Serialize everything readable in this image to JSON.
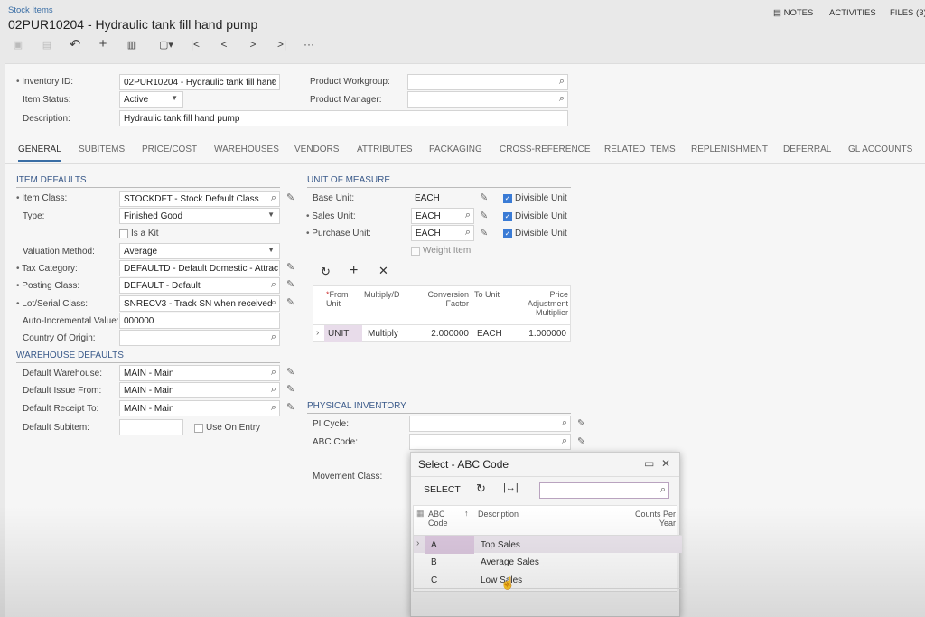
{
  "header": {
    "breadcrumb": "Stock Items",
    "title": "02PUR10204 - Hydraulic tank fill hand pump",
    "notes": "NOTES",
    "activities": "ACTIVITIES",
    "files": "FILES (3)"
  },
  "toolbar": {
    "icons": [
      "save-close-icon",
      "save-icon",
      "undo-icon",
      "add-icon",
      "delete-icon",
      "copy-paste-icon",
      "first-icon",
      "previous-icon",
      "next-icon",
      "last-icon",
      "more-icon"
    ],
    "glyphs": {
      "undo": "↶",
      "add": "+",
      "delete": "🗑",
      "copy": "▢▾",
      "first": "|<",
      "prev": "<",
      "next": ">",
      "last": ">|",
      "more": "···"
    }
  },
  "summary": {
    "inventory_id_label": "Inventory ID:",
    "inventory_id": "02PUR10204 - Hydraulic tank fill hand",
    "item_status_label": "Item Status:",
    "item_status": "Active",
    "description_label": "Description:",
    "description": "Hydraulic tank fill hand pump",
    "product_workgroup_label": "Product Workgroup:",
    "product_workgroup": "",
    "product_manager_label": "Product Manager:",
    "product_manager": ""
  },
  "tabs": [
    "GENERAL",
    "SUBITEMS",
    "PRICE/COST",
    "WAREHOUSES",
    "VENDORS",
    "ATTRIBUTES",
    "PACKAGING",
    "CROSS-REFERENCE",
    "RELATED ITEMS",
    "REPLENISHMENT",
    "DEFERRAL",
    "GL ACCOUNTS"
  ],
  "item_defaults": {
    "header": "ITEM DEFAULTS",
    "item_class_label": "Item Class:",
    "item_class": "STOCKDFT - Stock Default Class",
    "type_label": "Type:",
    "type": "Finished Good",
    "is_kit_label": "Is a Kit",
    "is_kit": false,
    "valuation_label": "Valuation Method:",
    "valuation": "Average",
    "tax_label": "Tax Category:",
    "tax": "DEFAULTD - Default Domestic - Attrac",
    "posting_label": "Posting Class:",
    "posting": "DEFAULT - Default",
    "lot_label": "Lot/Serial Class:",
    "lot": "SNRECV3 - Track SN when received",
    "auto_label": "Auto-Incremental Value:",
    "auto": "000000",
    "country_label": "Country Of Origin:",
    "country": ""
  },
  "warehouse_defaults": {
    "header": "WAREHOUSE DEFAULTS",
    "warehouse_label": "Default Warehouse:",
    "warehouse": "MAIN - Main",
    "issue_label": "Default Issue From:",
    "issue": "MAIN - Main",
    "receipt_label": "Default Receipt To:",
    "receipt": "MAIN - Main",
    "subitem_label": "Default Subitem:",
    "subitem": "",
    "use_on_entry_label": "Use On Entry",
    "use_on_entry": false
  },
  "uom": {
    "header": "UNIT OF MEASURE",
    "base_label": "Base Unit:",
    "base": "EACH",
    "sales_label": "Sales Unit:",
    "sales": "EACH",
    "purchase_label": "Purchase Unit:",
    "purchase": "EACH",
    "divisible_label": "Divisible Unit",
    "weight_item_label": "Weight Item",
    "grid": {
      "columns": [
        "From Unit",
        "Multiply/D",
        "Conversion Factor",
        "To Unit",
        "Price Adjustment Multiplier"
      ],
      "rows": [
        {
          "from": "UNIT",
          "op": "Multiply",
          "factor": "2.000000",
          "to": "EACH",
          "mult": "1.000000"
        }
      ]
    }
  },
  "physical": {
    "header": "PHYSICAL INVENTORY",
    "pi_label": "PI Cycle:",
    "pi": "",
    "abc_label": "ABC Code:",
    "abc": "",
    "movement_label": "Movement Class:"
  },
  "dialog": {
    "title": "Select - ABC Code",
    "select": "SELECT",
    "search_placeholder": "",
    "columns": [
      "ABC Code",
      "Description",
      "Counts Per Year"
    ],
    "rows": [
      {
        "code": "A",
        "desc": "Top Sales",
        "counts": ""
      },
      {
        "code": "B",
        "desc": "Average Sales",
        "counts": ""
      },
      {
        "code": "C",
        "desc": "Low Sales",
        "counts": ""
      }
    ]
  },
  "colors": {
    "accent": "#3a6ea5",
    "selected_row": "#e8dcea",
    "checkbox": "#3a7bd5"
  }
}
